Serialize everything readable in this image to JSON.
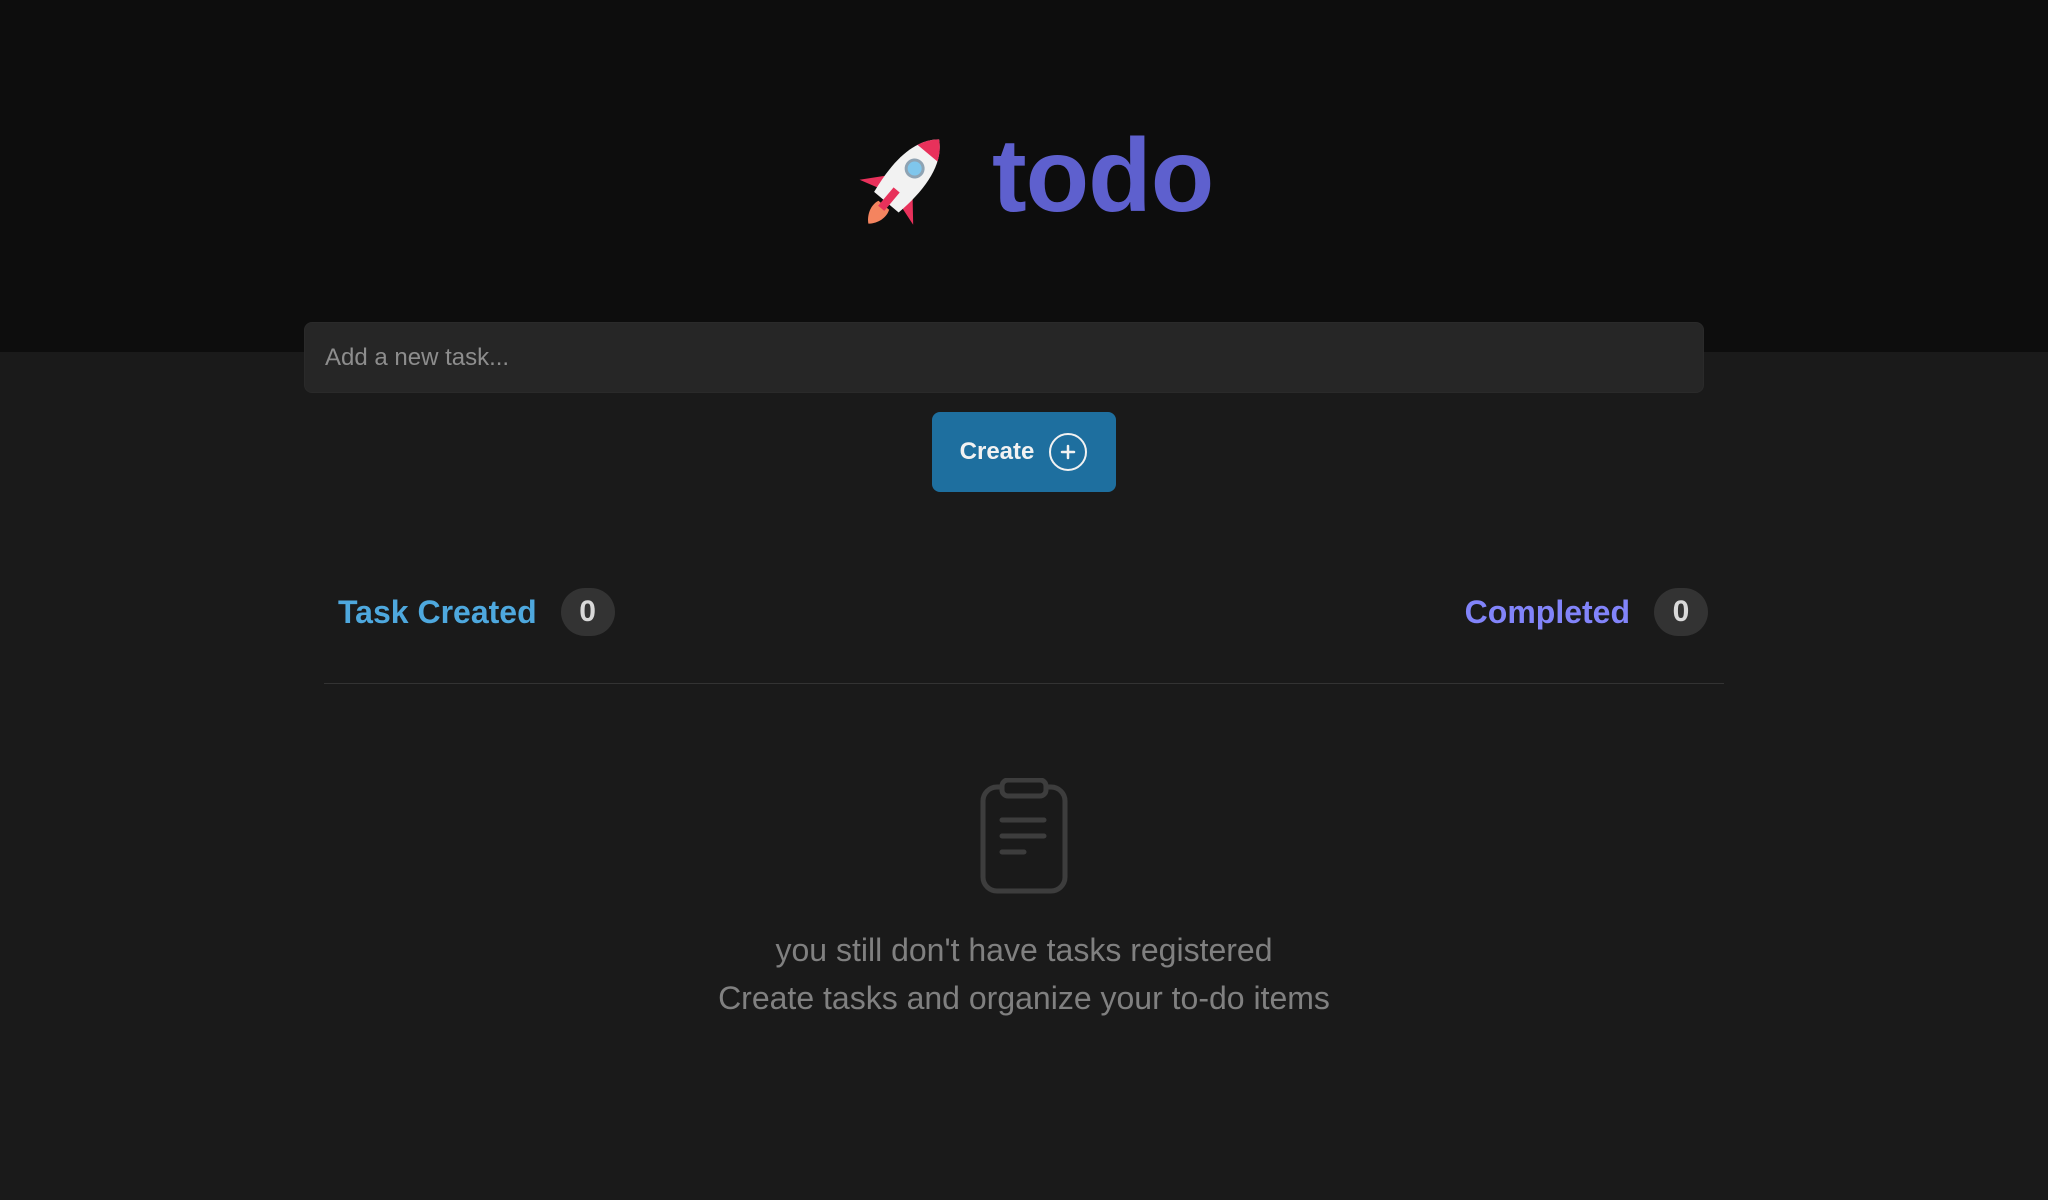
{
  "app": {
    "logo_text": "todo",
    "logo_icon": "rocket-icon",
    "accent_color": "#5e60ce"
  },
  "new_task": {
    "placeholder": "Add a new task...",
    "value": "",
    "create_label": "Create",
    "create_icon": "plus-circle-icon",
    "button_color": "#1e6f9f"
  },
  "stats": {
    "created_label": "Task Created",
    "created_count": "0",
    "created_color": "#4ea8de",
    "completed_label": "Completed",
    "completed_count": "0",
    "completed_color": "#8284fa"
  },
  "empty_state": {
    "icon": "clipboard-icon",
    "title": "you still don't have tasks registered",
    "subtitle": "Create tasks and organize your to-do items"
  }
}
